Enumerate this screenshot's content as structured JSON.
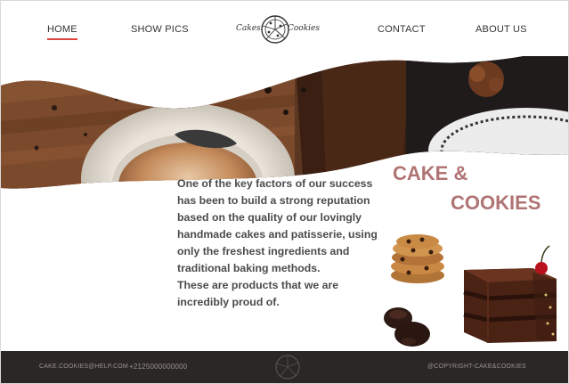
{
  "nav": {
    "home": "HOME",
    "show_pics": "SHOW PICS",
    "contact": "CONTACT",
    "about": "ABOUT US"
  },
  "logo": {
    "word1": "Cakes",
    "word2": "Cookies"
  },
  "hero": {
    "title_line1": "CAKE &",
    "title_line2": "COOKIES",
    "body": "One of the key factors of our success\n has been to build a strong reputation\nbased on the quality of our lovingly\n handmade cakes and patisserie, using\n only the freshest ingredients and\ntraditional baking methods.\nThese are products that we are\n incredibly proud of."
  },
  "footer": {
    "email": "CAKE.COOKIES@HELP.COM",
    "phone": "+2125000000000",
    "copyright": "@COPYRIGHT-CAKE&COOKIES"
  },
  "colors": {
    "accent_underline": "#e0443e",
    "title": "#b07474",
    "footer_bg": "#2b2727"
  },
  "icons": [
    "pizza-logo-icon",
    "footer-logo-icon"
  ]
}
